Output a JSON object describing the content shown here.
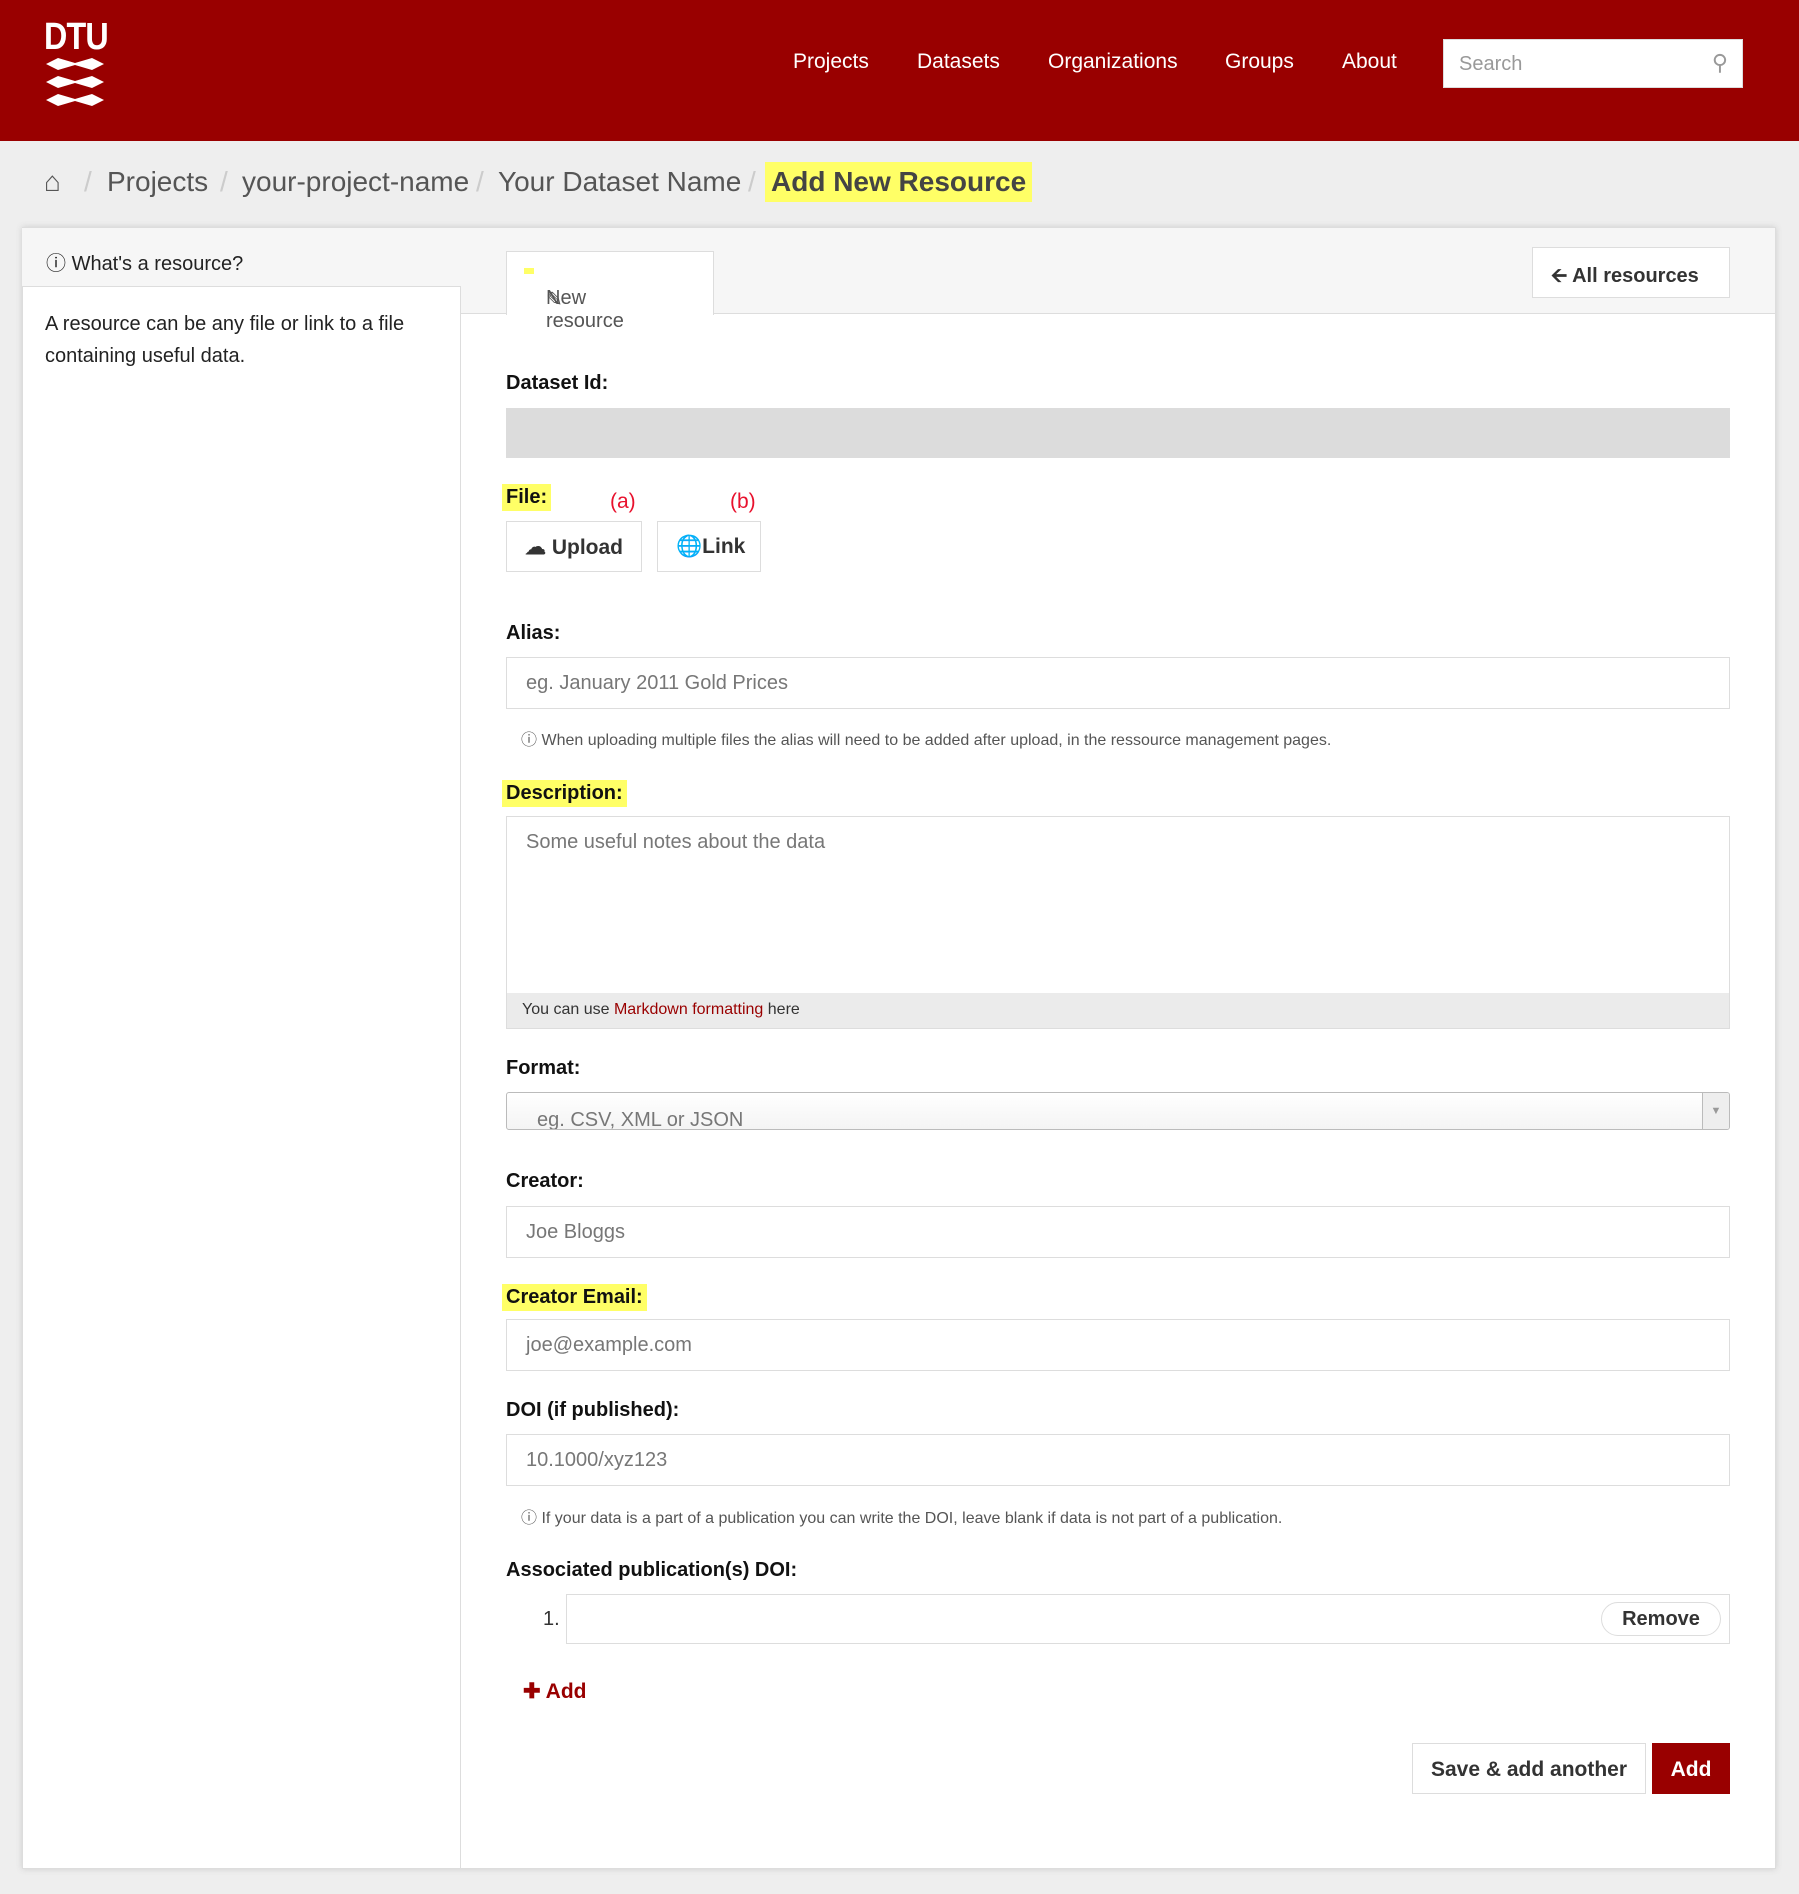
{
  "header": {
    "logo": "DTU",
    "nav": [
      "Projects",
      "Datasets",
      "Organizations",
      "Groups",
      "About"
    ],
    "search_placeholder": "Search",
    "brand_color": "#990000"
  },
  "breadcrumb": [
    "Projects",
    "your-project-name",
    "Your Dataset Name",
    "Add New Resource"
  ],
  "sidebar": {
    "title": "What's a resource?",
    "text": "A resource can be any file or link to a file containing useful data."
  },
  "tabs": {
    "active": "New resource",
    "all_resources": "All resources"
  },
  "form": {
    "dataset_id_label": "Dataset Id:",
    "file_label": "File:",
    "upload": "Upload",
    "link": "Link",
    "annot_a": "(a)",
    "annot_b": "(b)",
    "alias_label": "Alias:",
    "alias_placeholder": "eg. January 2011 Gold Prices",
    "alias_help": "When uploading multiple files the alias will need to be added after upload, in the ressource management pages.",
    "description_label": "Description:",
    "description_placeholder": "Some useful notes about the data",
    "md_pre": "You can use ",
    "md_link": "Markdown formatting",
    "md_post": " here",
    "format_label": "Format:",
    "format_placeholder": "eg. CSV, XML or JSON",
    "creator_label": "Creator:",
    "creator_placeholder": "Joe Bloggs",
    "email_label": "Creator Email:",
    "email_placeholder": "joe@example.com",
    "doi_label": "DOI (if published):",
    "doi_placeholder": "10.1000/xyz123",
    "doi_help": "If your data is a part of a publication you can write the DOI, leave blank if data is not part of a publication.",
    "assoc_label": "Associated publication(s) DOI:",
    "assoc_index": "1.",
    "remove": "Remove",
    "add_link": "Add",
    "save_another": "Save & add another",
    "submit": "Add"
  }
}
